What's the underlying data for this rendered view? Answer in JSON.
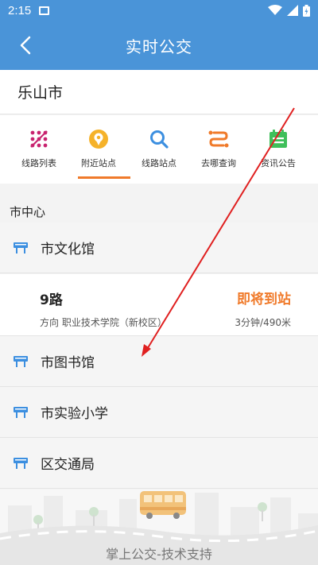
{
  "status_bar": {
    "time": "2:15"
  },
  "app_bar": {
    "title": "实时公交"
  },
  "city": {
    "name": "乐山市"
  },
  "tabs": [
    {
      "label": "线路列表",
      "icon": "route-list-icon",
      "active": false
    },
    {
      "label": "附近站点",
      "icon": "nearby-location-icon",
      "active": true
    },
    {
      "label": "线路站点",
      "icon": "search-icon",
      "active": false
    },
    {
      "label": "去哪查询",
      "icon": "destination-route-icon",
      "active": false
    },
    {
      "label": "资讯公告",
      "icon": "news-calendar-icon",
      "active": false
    }
  ],
  "section": {
    "title": "市中心"
  },
  "stops": [
    {
      "name": "市文化馆"
    },
    {
      "name": "市图书馆"
    },
    {
      "name": "市实验小学"
    },
    {
      "name": "区交通局"
    }
  ],
  "route": {
    "name": "9路",
    "direction": "方向 职业技术学院（新校区）",
    "arrival": "即将到站",
    "distance": "3分钟/490米"
  },
  "footer": {
    "text": "掌上公交-技术支持"
  },
  "colors": {
    "primary": "#4a94d8",
    "accent": "#f07a2a",
    "annotation_arrow": "#e02020"
  }
}
